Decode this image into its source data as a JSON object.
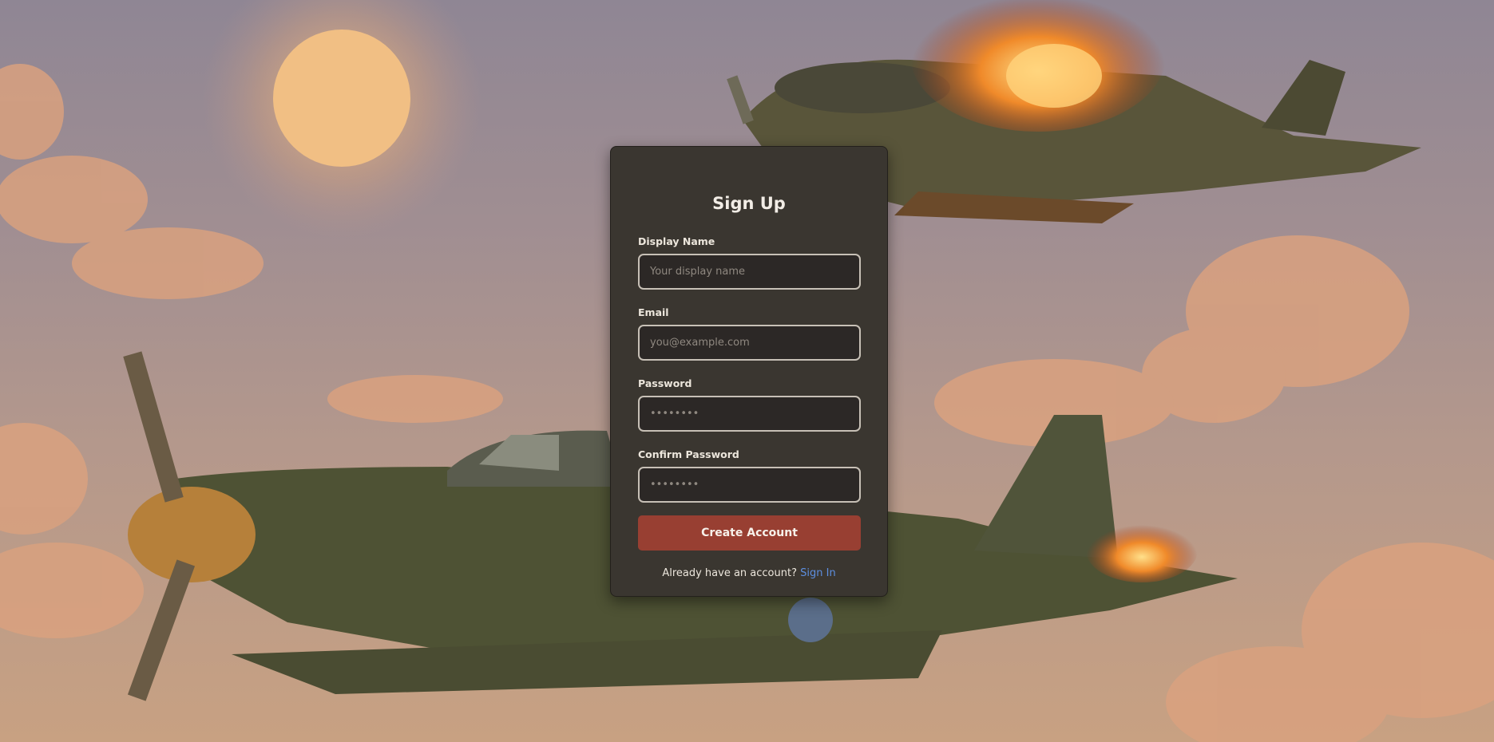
{
  "form": {
    "title": "Sign Up",
    "fields": [
      {
        "label": "Display Name",
        "placeholder": "Your display name",
        "value": ""
      },
      {
        "label": "Email",
        "placeholder": "you@example.com",
        "value": ""
      },
      {
        "label": "Password",
        "placeholder": "••••••••",
        "value": ""
      },
      {
        "label": "Confirm Password",
        "placeholder": "••••••••",
        "value": ""
      }
    ],
    "submit_label": "Create Account",
    "footer_text": "Already have an account?",
    "footer_link": "Sign In"
  },
  "background": {
    "icons": [
      "sun-icon",
      "cloud-icon",
      "burning-plane-icon",
      "fighter-plane-icon"
    ]
  },
  "colors": {
    "card": "#3a3630",
    "input_bg": "#2c2826",
    "input_border": "#c7c0b6",
    "button": "#983f32",
    "link": "#5d8fe0"
  }
}
